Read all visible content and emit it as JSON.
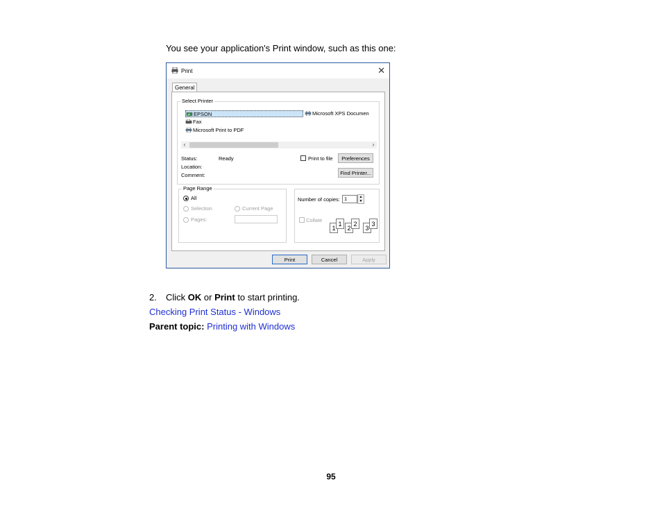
{
  "intro": "You see your application's Print window, such as this one:",
  "dialog": {
    "title": "Print",
    "close": "✕",
    "tab": "General",
    "select_printer": {
      "label": "Select Printer",
      "printers": [
        "EPSON",
        "Fax",
        "Microsoft Print to PDF",
        "Microsoft XPS Documen"
      ],
      "scroll_left": "‹",
      "scroll_right": "›"
    },
    "status": {
      "label": "Status:",
      "value": "Ready"
    },
    "location": {
      "label": "Location:"
    },
    "comment": {
      "label": "Comment:"
    },
    "print_to_file": "Print to file",
    "preferences": "Preferences",
    "find_printer": "Find Printer...",
    "page_range": {
      "label": "Page Range",
      "all": "All",
      "selection": "Selection",
      "current_page": "Current Page",
      "pages": "Pages:"
    },
    "copies": {
      "label": "Number of copies:",
      "value": "1"
    },
    "collate": "Collate",
    "collate_pages": [
      "1",
      "1",
      "2",
      "2",
      "3",
      "3"
    ],
    "buttons": {
      "print": "Print",
      "cancel": "Cancel",
      "apply": "Apply"
    }
  },
  "step": {
    "number": "2.",
    "pre": "Click ",
    "ok": "OK",
    "or": " or ",
    "print": "Print",
    "post": " to start printing."
  },
  "link_checking": "Checking Print Status - Windows",
  "parent": {
    "label": "Parent topic:",
    "link": "Printing with Windows"
  },
  "page_number": "95",
  "colors": {
    "link": "#1f2fd0",
    "dialog_border": "#2a5aa0",
    "selection": "#cce4f7"
  }
}
